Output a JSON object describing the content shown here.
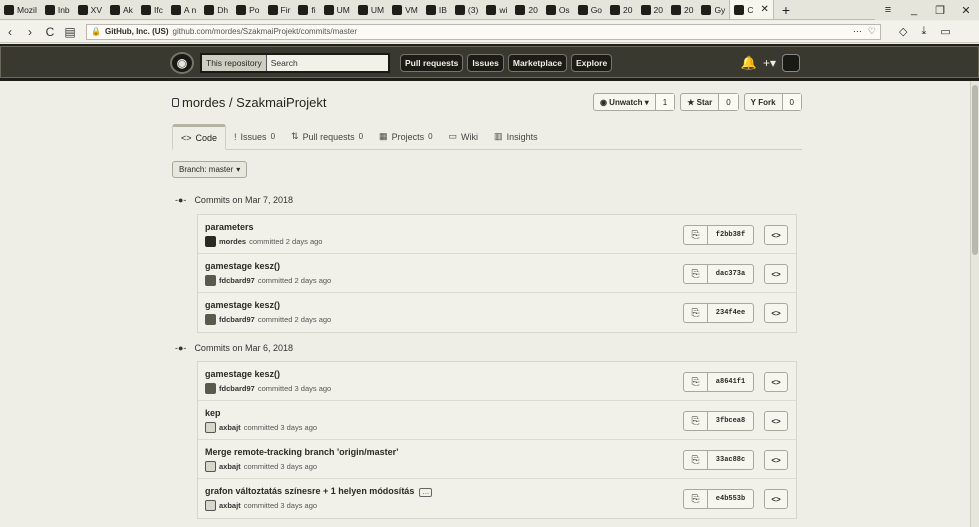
{
  "browser": {
    "tabs": [
      {
        "label": "Mozil"
      },
      {
        "label": "Inb"
      },
      {
        "label": "XV"
      },
      {
        "label": "Ak"
      },
      {
        "label": "Ifc"
      },
      {
        "label": "A n"
      },
      {
        "label": "Dh"
      },
      {
        "label": "Po"
      },
      {
        "label": "Fir"
      },
      {
        "label": "fi"
      },
      {
        "label": "UM"
      },
      {
        "label": "UM"
      },
      {
        "label": "VM"
      },
      {
        "label": "IB"
      },
      {
        "label": "(3)"
      },
      {
        "label": "wi"
      },
      {
        "label": "20"
      },
      {
        "label": "Os"
      },
      {
        "label": "Go"
      },
      {
        "label": "20"
      },
      {
        "label": "20"
      },
      {
        "label": "20"
      },
      {
        "label": "Gy"
      }
    ],
    "active_tab": {
      "label": "C"
    },
    "url_secure_label": "GitHub, Inc. (US)",
    "url": "github.com/mordes/SzakmaiProjekt/commits/master"
  },
  "header": {
    "search_scope": "This repository",
    "search_placeholder": "Search",
    "nav": [
      "Pull requests",
      "Issues",
      "Marketplace",
      "Explore"
    ]
  },
  "repo": {
    "owner_repo": "mordes / SzakmaiProjekt",
    "watch": {
      "label": "Unwatch",
      "count": "1"
    },
    "star": {
      "label": "Star",
      "count": "0"
    },
    "fork": {
      "label": "Fork",
      "count": "0"
    }
  },
  "reponav": [
    {
      "icon": "<>",
      "label": "Code",
      "count": ""
    },
    {
      "icon": "!",
      "label": "Issues",
      "count": "0"
    },
    {
      "icon": "⇅",
      "label": "Pull requests",
      "count": "0"
    },
    {
      "icon": "▦",
      "label": "Projects",
      "count": "0"
    },
    {
      "icon": "▭",
      "label": "Wiki",
      "count": ""
    },
    {
      "icon": "▥",
      "label": "Insights",
      "count": ""
    }
  ],
  "branch": "Branch: master",
  "days": [
    {
      "date": "Commits on Mar 7, 2018",
      "commits": [
        {
          "title": "parameters",
          "author": "mordes",
          "time": "committed 2 days ago",
          "sha": "f2bb38f"
        },
        {
          "title": "gamestage kesz()",
          "author": "fdcbard97",
          "time": "committed 2 days ago",
          "sha": "dac373a"
        },
        {
          "title": "gamestage kesz()",
          "author": "fdcbard97",
          "time": "committed 2 days ago",
          "sha": "234f4ee"
        }
      ]
    },
    {
      "date": "Commits on Mar 6, 2018",
      "commits": [
        {
          "title": "gamestage kesz()",
          "author": "fdcbard97",
          "time": "committed 3 days ago",
          "sha": "a8641f1"
        },
        {
          "title": "kep",
          "author": "axbajt",
          "time": "committed 3 days ago",
          "sha": "3fbcea8"
        },
        {
          "title": "Merge remote-tracking branch 'origin/master'",
          "author": "axbajt",
          "time": "committed 3 days ago",
          "sha": "33ac88c"
        },
        {
          "title": "grafon változtatás színesre + 1 helyen módosítás",
          "author": "axbajt",
          "time": "committed 3 days ago",
          "sha": "e4b553b"
        }
      ]
    }
  ]
}
